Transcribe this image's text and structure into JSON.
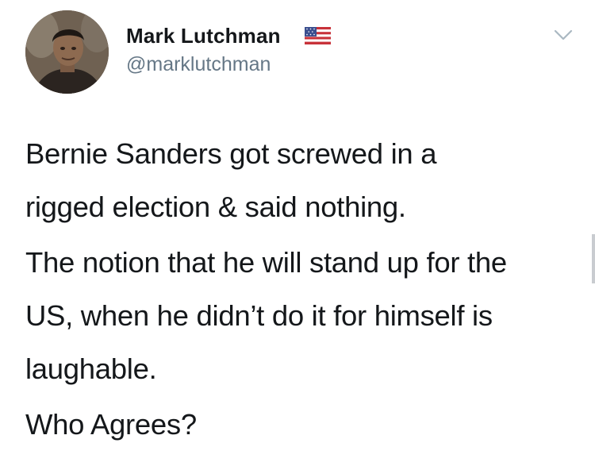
{
  "tweet": {
    "author": {
      "display_name": "Mark Lutchman",
      "handle": "@marklutchman",
      "avatar_icon": "user-avatar-photo",
      "badge_icon": "us-flag-icon"
    },
    "menu_icon": "chevron-down-icon",
    "paragraphs": [
      {
        "lines": [
          "Bernie Sanders got screwed in a",
          "rigged election & said nothing."
        ]
      },
      {
        "lines": [
          "The notion that he will stand up for the",
          "US, when he didn’t do it for himself is",
          "laughable."
        ]
      },
      {
        "lines": [
          "Who Agrees?"
        ]
      }
    ]
  },
  "colors": {
    "text_primary": "#14171a",
    "text_secondary": "#657786",
    "background": "#ffffff"
  }
}
